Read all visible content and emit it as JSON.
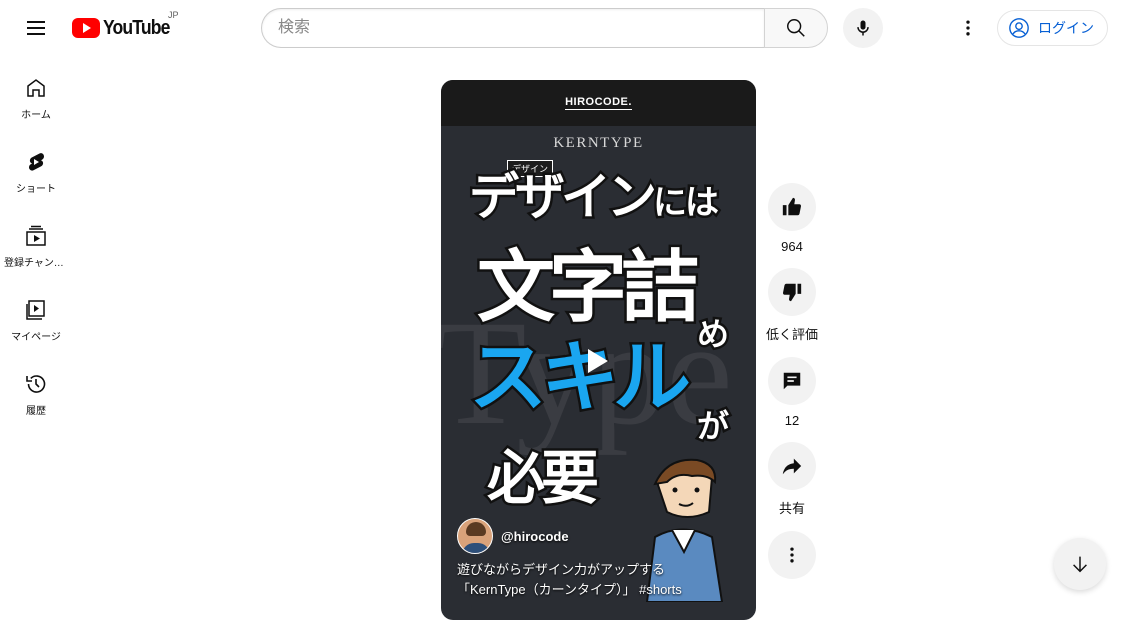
{
  "header": {
    "logo_text": "YouTube",
    "region": "JP",
    "search_placeholder": "検索",
    "login_label": "ログイン"
  },
  "sidebar": {
    "items": [
      {
        "label": "ホーム",
        "icon": "home-icon"
      },
      {
        "label": "ショート",
        "icon": "shorts-icon"
      },
      {
        "label": "登録チャンネル",
        "icon": "subscriptions-icon"
      },
      {
        "label": "マイページ",
        "icon": "library-icon"
      },
      {
        "label": "履歴",
        "icon": "history-icon"
      }
    ]
  },
  "short": {
    "brand": "HIROCODE.",
    "kern_title": "KERNTYPE",
    "category_tag": "デザイン",
    "line1_big": "デザイン",
    "line1_small": "には",
    "line2": "文字詰",
    "line2_small": "め",
    "line3": "スキル",
    "line3_small": "が",
    "line4": "必要",
    "bg_letters": "Type",
    "channel": "@hirocode",
    "caption_line1": "遊びながらデザイン力がアップする",
    "caption_line2": "「KernType（カーンタイプ）」 #shorts"
  },
  "actions": {
    "like_count": "964",
    "dislike_label": "低く評価",
    "comment_count": "12",
    "share_label": "共有"
  },
  "colors": {
    "brand_red": "#ff0000",
    "accent_blue": "#1aa6f0",
    "link_blue": "#065fd4"
  }
}
